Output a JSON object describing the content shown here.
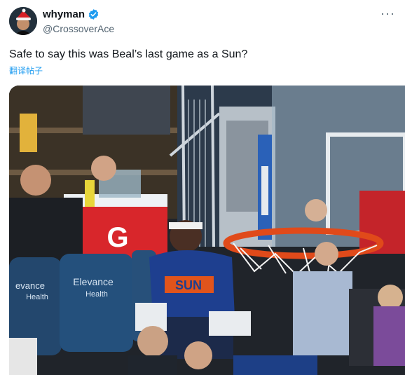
{
  "author": {
    "display_name": "whyman",
    "handle": "@CrossoverAce",
    "verified_icon": "verified-badge-icon",
    "avatar_icon": "avatar-santa-hat"
  },
  "menu": {
    "more_label": "···"
  },
  "tweet": {
    "text": "Safe to say this was Beal’s last game as a Sun?",
    "translate_label": "翻译帖子"
  },
  "media": {
    "cooler_letter": "G",
    "seat_brand_line1": "Elevance",
    "seat_brand_line2": "Health",
    "seat_brand_left_line1": "evance",
    "seat_brand_left_line2": "Health",
    "jersey_text": "SUN",
    "colors": {
      "accent": "#1d9bf0",
      "cooler_red": "#d8262b",
      "seat_blue": "#23476d",
      "rim_orange": "#e04a1a"
    }
  }
}
